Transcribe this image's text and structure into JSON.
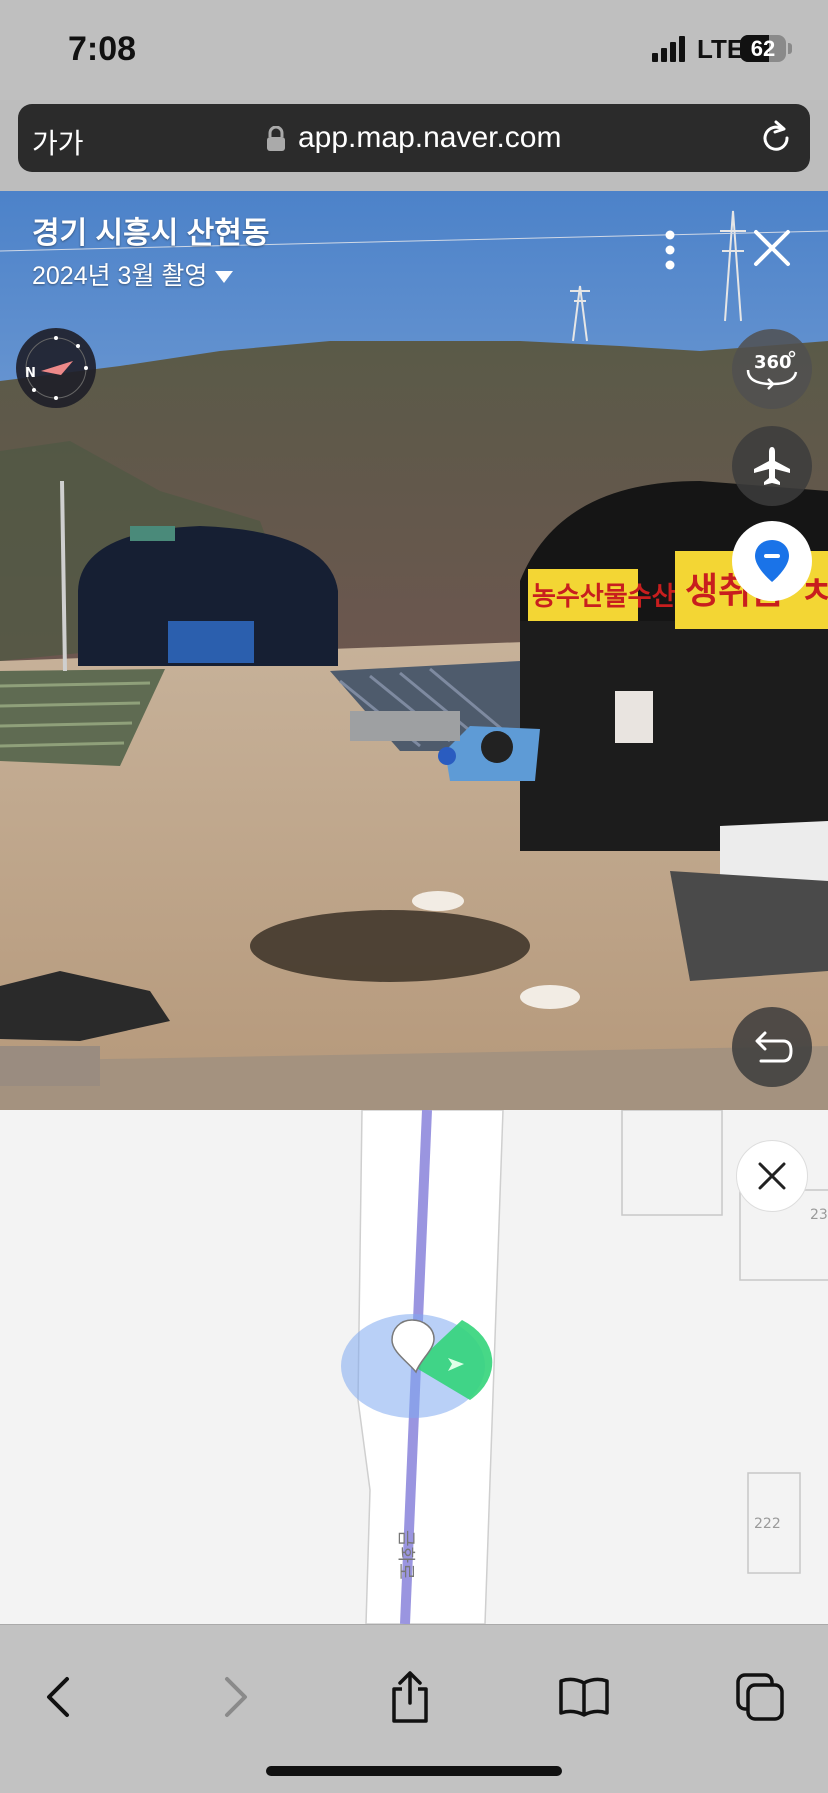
{
  "status_bar": {
    "time": "7:08",
    "network": "LTE",
    "battery_level": "62"
  },
  "browser": {
    "text_size_label": "가가",
    "url": "app.map.naver.com"
  },
  "street_view": {
    "location_title": "경기 시흥시 산현동",
    "capture_date": "2024년 3월 촬영",
    "sign_text_1": "농수산물수산",
    "sign_text_2": "생취즙",
    "sign_text_2_suffix": "ㅊ"
  },
  "map": {
    "road_label": "금화로",
    "building_labels": [
      "23",
      "222"
    ]
  },
  "colors": {
    "accent_blue": "#1a73e8",
    "view_cone_green": "#33d47a",
    "road_line": "#9a95e0"
  },
  "icons": {
    "compass": "compass-icon",
    "more": "more-vertical-icon",
    "close": "close-icon",
    "panorama": "360-icon",
    "aerial": "airplane-icon",
    "location": "location-pin-icon",
    "undo": "undo-icon",
    "back": "chevron-left-icon",
    "forward": "chevron-right-icon",
    "share": "share-icon",
    "bookmarks": "book-icon",
    "tabs": "tabs-icon"
  }
}
